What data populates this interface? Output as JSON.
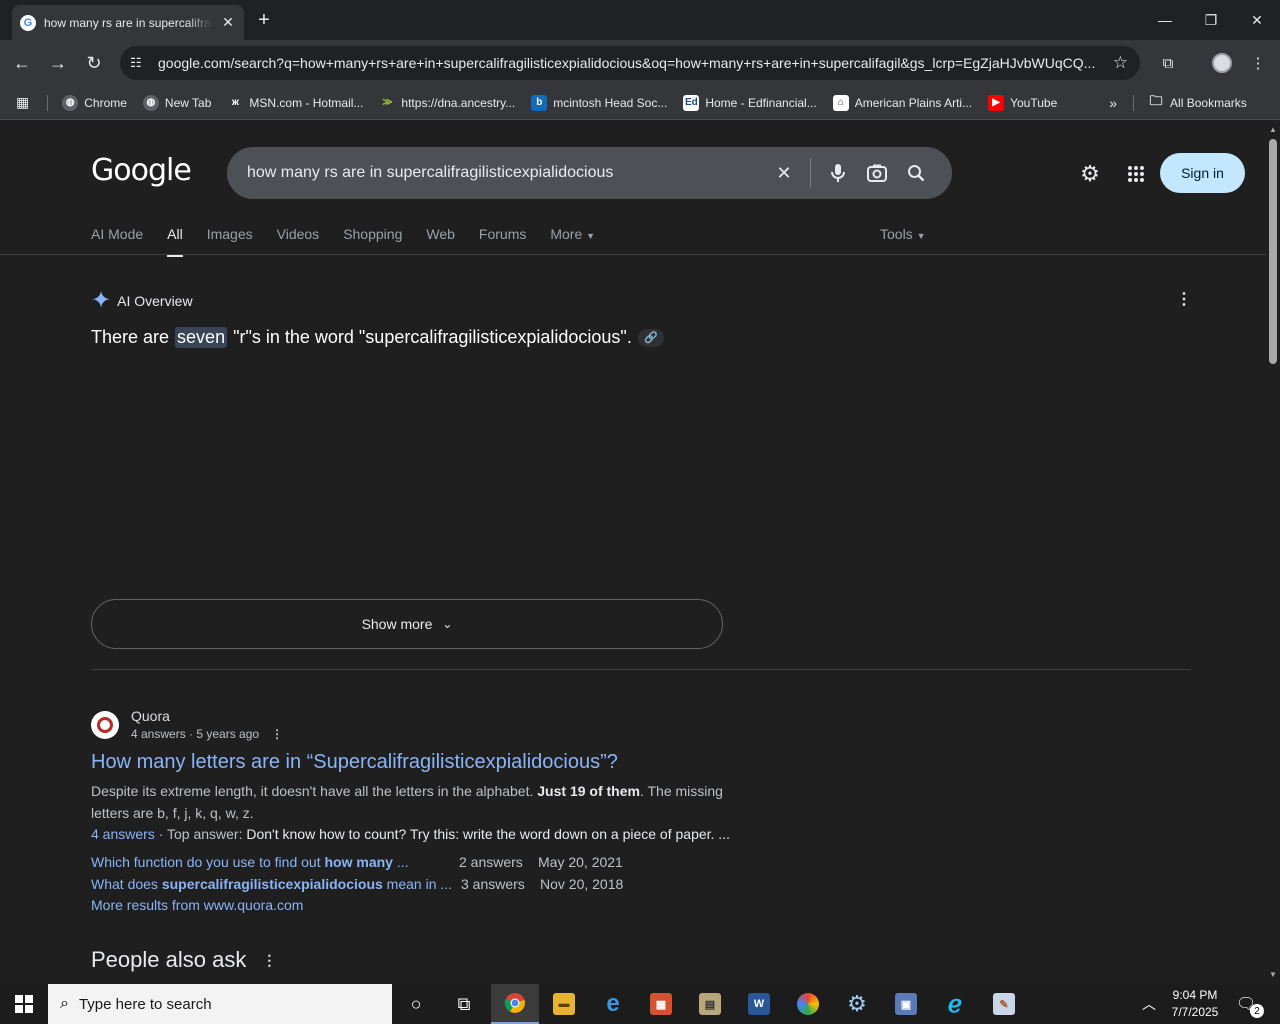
{
  "browser": {
    "tab_title": "how many rs are in supercalifragilisticexpialidocious - Google Search",
    "url": "google.com/search?q=how+many+rs+are+in+supercalifragilisticexpialidocious&oq=how+many+rs+are+in+supercalifagil&gs_lcrp=EgZjaHJvbWUqCQ...",
    "bookmarks": [
      {
        "label": "Chrome",
        "icon": "chrome-globe-icon"
      },
      {
        "label": "New Tab",
        "icon": "globe-icon"
      },
      {
        "label": "MSN.com - Hotmail...",
        "icon": "msn-butterfly-icon"
      },
      {
        "label": "https://dna.ancestry...",
        "icon": "ancestry-leaf-icon"
      },
      {
        "label": "mcintosh Head Soc...",
        "icon": "bing-icon"
      },
      {
        "label": "Home - Edfinancial...",
        "icon": "edfinancial-icon"
      },
      {
        "label": "American Plains Arti...",
        "icon": "museum-icon"
      },
      {
        "label": "YouTube",
        "icon": "youtube-icon"
      }
    ],
    "all_bookmarks_label": "All Bookmarks"
  },
  "search": {
    "logo": "Google",
    "query": "how many rs are in supercalifragilisticexpialidocious",
    "sign_in": "Sign in",
    "tabs": [
      "AI Mode",
      "All",
      "Images",
      "Videos",
      "Shopping",
      "Web",
      "Forums",
      "More"
    ],
    "active_tab": "All",
    "tools": "Tools"
  },
  "ai_overview": {
    "label": "AI Overview",
    "answer_before": "There are",
    "answer_highlight": "seven",
    "answer_after": "\"r\"s in the word \"supercalifragilisticexpialidocious\".",
    "show_more": "Show more"
  },
  "result": {
    "site": "Quora",
    "meta": "4 answers · 5 years ago",
    "title": "How many letters are in “Supercalifragilisticexpialidocious”?",
    "snippet_before": "Despite its extreme length, it doesn't have all the letters in the alphabet.",
    "snippet_bold": "Just 19 of them",
    "snippet_after": ". The missing letters are b, f, j, k, q, w, z.",
    "answers_link": "4 answers",
    "top_answer_label": "· Top answer:",
    "top_answer_text": "Don't know how to count? Try this: write the word down on a piece of paper. ...",
    "related": [
      {
        "text_before": "Which function do you use to find out ",
        "text_bold": "how many",
        "text_after": " ...",
        "count": "2 answers",
        "date": "May 20, 2021"
      },
      {
        "text_before": "What does ",
        "text_bold": "supercalifragilisticexpialidocious",
        "text_after": " mean in ...",
        "count": "3 answers",
        "date": "Nov 20, 2018"
      }
    ],
    "more_results": "More results from www.quora.com"
  },
  "people_also_ask": "People also ask",
  "taskbar": {
    "search_placeholder": "Type here to search",
    "time": "9:04 PM",
    "date": "7/7/2025",
    "notification_count": "2"
  }
}
